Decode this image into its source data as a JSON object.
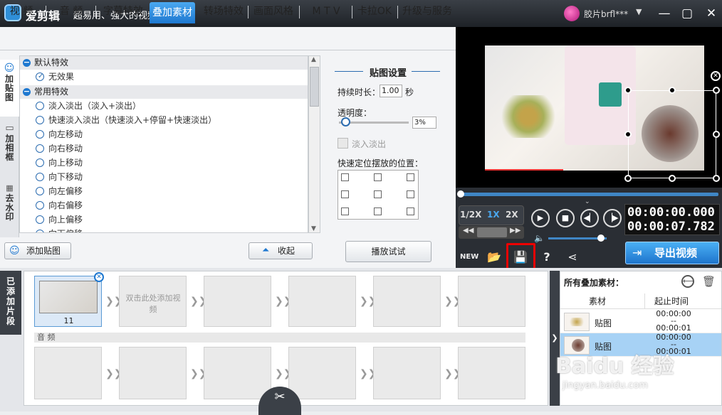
{
  "app": {
    "name": "爱剪辑",
    "slogan": "超易用、强大的视频剪辑软件",
    "user": "胶片brfl***"
  },
  "tabs": [
    {
      "label": "视 频"
    },
    {
      "label": "音 频"
    },
    {
      "label": "字幕特效"
    },
    {
      "label": "叠加素材"
    },
    {
      "label": "转场特效"
    },
    {
      "label": "画面风格"
    },
    {
      "label": "M T V"
    },
    {
      "label": "卡拉OK"
    },
    {
      "label": "升级与服务"
    }
  ],
  "side_tabs": [
    {
      "label": "加贴图"
    },
    {
      "label": "加相框"
    },
    {
      "label": "去水印"
    }
  ],
  "effects": {
    "groups": [
      {
        "label": "默认特效",
        "items": [
          "无效果"
        ]
      },
      {
        "label": "常用特效",
        "items": [
          "淡入淡出（淡入+淡出）",
          "快速淡入淡出（快速淡入+停留+快速淡出）",
          "向左移动",
          "向右移动",
          "向上移动",
          "向下移动",
          "向左偏移",
          "向右偏移",
          "向上偏移",
          "向下偏移"
        ]
      }
    ]
  },
  "settings": {
    "title": "贴图设置",
    "duration_label": "持续时长：",
    "duration": "1.00",
    "duration_unit": "秒",
    "opacity_label": "透明度：",
    "opacity": "3%",
    "opacity_level": 0.03,
    "fade_label": "淡入淡出",
    "position_label": "快速定位摆放的位置："
  },
  "buttons": {
    "add_sticker": "添加贴图",
    "collapse": "收起",
    "play_try": "播放试试",
    "export": "导出视频"
  },
  "player": {
    "speeds": [
      "1/2X",
      "1X",
      "2X"
    ],
    "active_speed": "1X",
    "time_current": "00:00:00.000",
    "time_total": "00:00:07.782",
    "progress": 0.0,
    "volume": 0.9
  },
  "timeline": {
    "tab_label": "已添加片段",
    "clip_caption": "11",
    "add_hint": "双击此处添加视频",
    "audio_label": "音 频"
  },
  "overlay_list": {
    "title": "所有叠加素材：",
    "col_material": "素材",
    "col_time": "起止时间",
    "rows": [
      {
        "name": "贴图",
        "start": "00:00:00",
        "end": "00:00:01"
      },
      {
        "name": "贴图",
        "start": "00:00:00",
        "end": "00:00:01"
      }
    ]
  },
  "watermark": {
    "line1": "Baidu 经验",
    "line2": "jingyan.baidu.com"
  },
  "colors": {
    "accent": "#1e78d0",
    "highlight": "#e00000",
    "selected_row": "#a7d2f5"
  }
}
